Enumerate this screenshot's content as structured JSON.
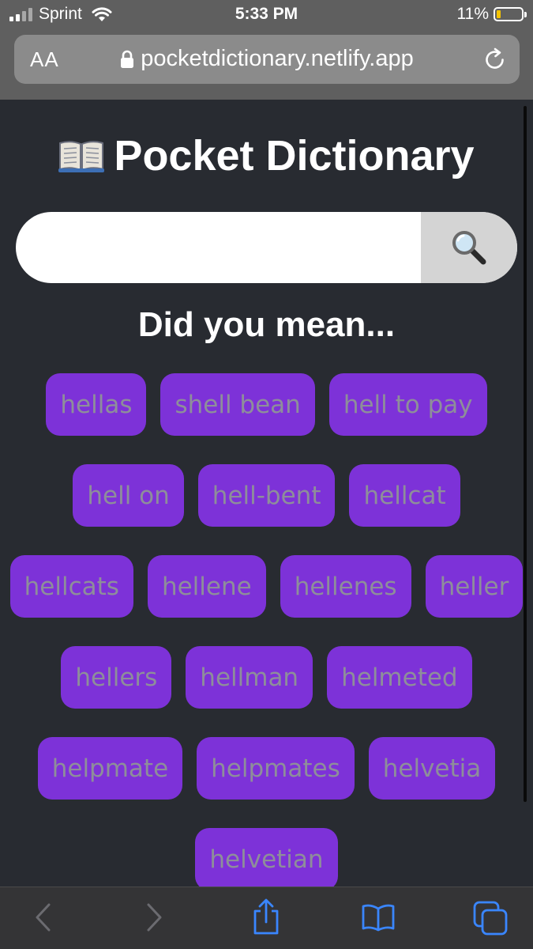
{
  "status_bar": {
    "carrier": "Sprint",
    "time": "5:33 PM",
    "battery": "11%",
    "battery_level": 0.11
  },
  "browser": {
    "text_size_label": "AA",
    "url": "pocketdictionary.netlify.app"
  },
  "page": {
    "title": "Pocket Dictionary",
    "search_value": "",
    "subtitle": "Did you mean...",
    "suggestion_rows": [
      [
        "hellas",
        "shell bean",
        "hell to pay"
      ],
      [
        "hell on",
        "hell-bent",
        "hellcat"
      ],
      [
        "hellcats",
        "hellene",
        "hellenes",
        "heller"
      ],
      [
        "hellers",
        "hellman",
        "helmeted"
      ],
      [
        "helpmate",
        "helpmates",
        "helvetia"
      ],
      [
        "helvetian"
      ]
    ]
  },
  "colors": {
    "background": "#282b31",
    "chip_background": "#7d32d8",
    "chip_text": "#8e8e9a",
    "search_button": "#d4d4d4",
    "toolbar_accent": "#3a86ff"
  },
  "icons": {
    "title": "open-book-icon",
    "search": "magnifying-glass-icon",
    "toolbar": [
      "back-icon",
      "forward-icon",
      "share-icon",
      "bookmarks-icon",
      "tabs-icon"
    ]
  }
}
